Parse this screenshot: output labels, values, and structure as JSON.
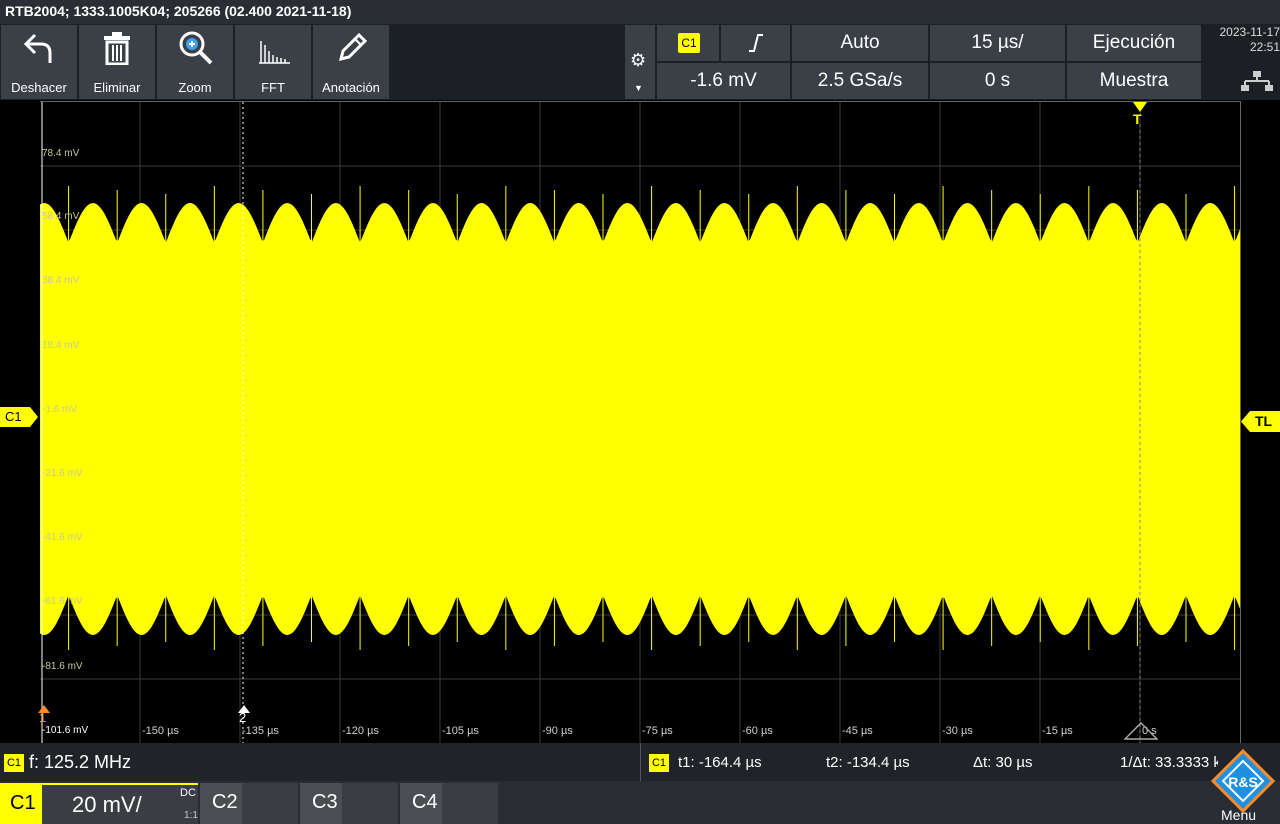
{
  "title": "RTB2004; 1333.1005K04; 205266 (02.400 2021-11-18)",
  "toolbar": {
    "undo": "Deshacer",
    "delete": "Eliminar",
    "zoom": "Zoom",
    "fft": "FFT",
    "annotation": "Anotación"
  },
  "trigger": {
    "source": "C1",
    "level": "-1.6 mV",
    "mode": "Auto",
    "sample_rate": "2.5 GSa/s",
    "time_div": "15 µs/",
    "position": "0 s",
    "run_state": "Ejecución",
    "acq_mode": "Muestra"
  },
  "datetime": {
    "date": "2023-11-17",
    "time": "22:51"
  },
  "plot": {
    "y_labels": [
      "78.4 mV",
      "58.4 mV",
      "38.4 mV",
      "18.4 mV",
      "-1.6 mV",
      "-21.6 mV",
      "-41.6 mV",
      "-61.6 mV",
      "-81.6 mV",
      "-101.6 mV"
    ],
    "x_labels": [
      "-150 µs",
      "-135 µs",
      "-120 µs",
      "-105 µs",
      "-90 µs",
      "-75 µs",
      "-60 µs",
      "-45 µs",
      "-30 µs",
      "-15 µs",
      "0 s"
    ],
    "ch_marker": "C1",
    "trigger_marker": "T",
    "trigger_level_marker": "TL",
    "cursor1_label": "1",
    "cursor2_label": "2",
    "trace_color": "#ffff00"
  },
  "measure": {
    "freq_ch": "C1",
    "freq": "f: 125.2 MHz",
    "cursor_ch": "C1",
    "t1": "t1: -164.4 µs",
    "t2": "t2: -134.4 µs",
    "dt": "Δt: 30 µs",
    "inv_dt": "1/Δt: 33.3333 kHz"
  },
  "channels": {
    "c1": "C1",
    "c1_scale": "20 mV/",
    "c1_coupling": "DC",
    "c1_probe": "1:1",
    "c2": "C2",
    "c3": "C3",
    "c4": "C4"
  },
  "menu": "Menu"
}
